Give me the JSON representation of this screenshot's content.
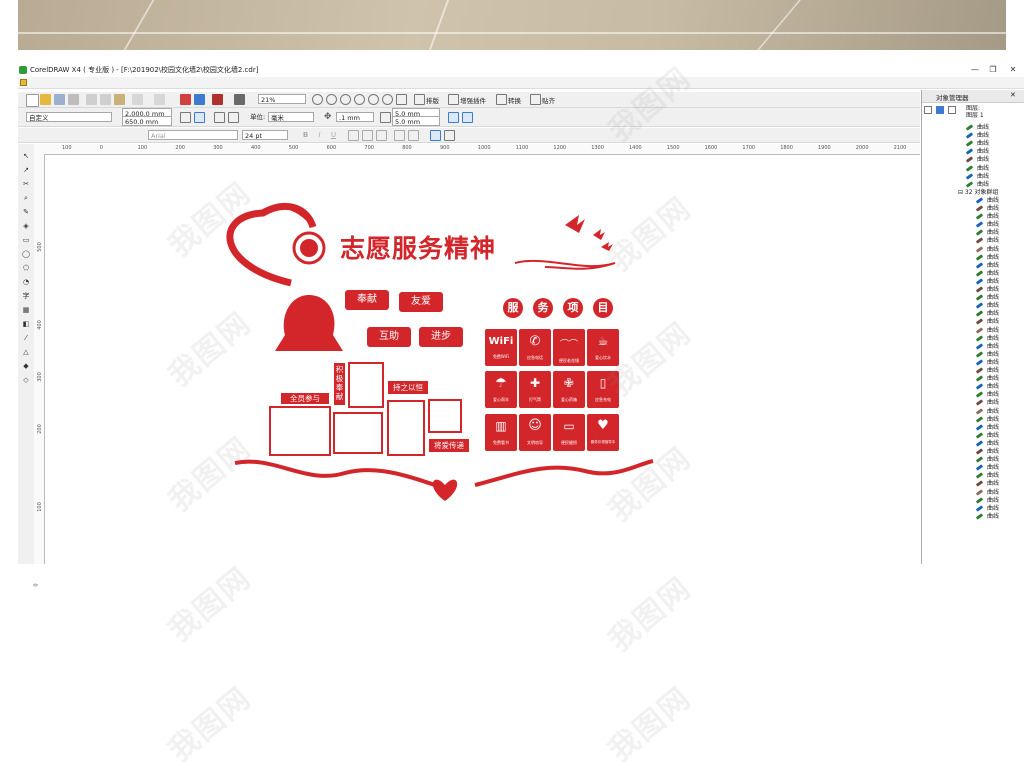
{
  "window": {
    "title": "CorelDRAW X4 ( 专业版 ) - [F:\\201902\\校园文化墙2\\校园文化墙2.cdr]",
    "minimize": "—",
    "restore": "❐",
    "close": "✕"
  },
  "toolbar": {
    "zoom": "21%",
    "arrange_label": "排版",
    "plugins_label": "增强插件",
    "convert_label": "转换",
    "paste_label": "贴齐"
  },
  "property_bar": {
    "paper_preset": "自定义",
    "width": "2,000.0 mm",
    "height": "650.0 mm",
    "units_label": "单位:",
    "units_value": "毫米",
    "nudge": ".1 mm",
    "dup_x": "5.0 mm",
    "dup_y": "5.0 mm"
  },
  "text_bar": {
    "font": "Arial",
    "font_size": "24 pt"
  },
  "ruler": {
    "h_ticks": [
      "100",
      "0",
      "100",
      "200",
      "300",
      "400",
      "500",
      "600",
      "700",
      "800",
      "900",
      "1000",
      "1100",
      "1200",
      "1300",
      "1400",
      "1500",
      "1600",
      "1700",
      "1800",
      "1900",
      "2000",
      "2100"
    ],
    "v_ticks": [
      "500",
      "",
      "",
      "400",
      "",
      "300",
      "",
      "200",
      "",
      "",
      "100",
      "",
      "",
      "0",
      ""
    ]
  },
  "design": {
    "title": "志愿服务精神",
    "tags": [
      "奉献",
      "友爱",
      "互助",
      "进步"
    ],
    "service_title_chars": [
      "服",
      "务",
      "项",
      "目"
    ],
    "label_all": "全员参与",
    "label_active": "积极奉献",
    "label_persist": "持之以恒",
    "label_love": "将爱传递",
    "icons": [
      {
        "glyph": "WiFi",
        "caption": "免费WiFi"
      },
      {
        "glyph": "✆",
        "caption": "应急电话"
      },
      {
        "glyph": "⌒⌒",
        "caption": "便民老花镜"
      },
      {
        "glyph": "☕",
        "caption": "爱心饮水"
      },
      {
        "glyph": "☂",
        "caption": "爱心雨伞"
      },
      {
        "glyph": "✚",
        "caption": "打气筒"
      },
      {
        "glyph": "✙",
        "caption": "爱心药箱"
      },
      {
        "glyph": "▯",
        "caption": "应急充电"
      },
      {
        "glyph": "▥",
        "caption": "免费看书"
      },
      {
        "glyph": "☺",
        "caption": "文明劝导"
      },
      {
        "glyph": "▭",
        "caption": "便民缝纫"
      },
      {
        "glyph": "♥",
        "caption": "服务引领指导中"
      }
    ],
    "brand_red": "#d3262b"
  },
  "docker": {
    "title": "对象管理器",
    "layer_root": "图层:",
    "layer_name": "图层 1",
    "group_label": "32 对象群组",
    "item_label": "曲线",
    "items_before_group": 8,
    "items_after_group": 40
  },
  "watermark": "我图网"
}
